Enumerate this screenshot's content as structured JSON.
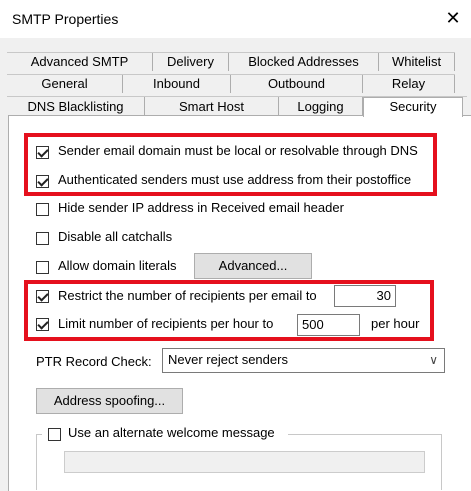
{
  "window": {
    "title": "SMTP Properties",
    "close_glyph": "✕"
  },
  "tabs": {
    "row1": [
      "Advanced SMTP",
      "Delivery",
      "Blocked Addresses",
      "Whitelist"
    ],
    "row2": [
      "General",
      "Inbound",
      "Outbound",
      "Relay"
    ],
    "row3": [
      "DNS Blacklisting",
      "Smart Host",
      "Logging",
      "Security"
    ],
    "active": "Security"
  },
  "security": {
    "sender_domain_local": {
      "label": "Sender email domain must be local or resolvable through DNS",
      "checked": true
    },
    "auth_senders_postoffice": {
      "label": "Authenticated senders must use address from their postoffice",
      "checked": true
    },
    "hide_sender_ip": {
      "label": "Hide sender IP address in Received email header",
      "checked": false
    },
    "disable_catchalls": {
      "label": "Disable all catchalls",
      "checked": false
    },
    "allow_domain_literals": {
      "label": "Allow domain literals",
      "checked": false
    },
    "advanced_button": "Advanced...",
    "restrict_recipients_email": {
      "label": "Restrict the number of recipients per email to",
      "checked": true,
      "value": "30"
    },
    "limit_recipients_hour": {
      "label": "Limit number of recipients per hour to",
      "checked": true,
      "value": "500",
      "suffix": "per hour"
    },
    "ptr_label": "PTR Record Check:",
    "ptr_value": "Never reject senders",
    "address_spoofing_button": "Address spoofing...",
    "alternate_welcome": {
      "label": "Use an alternate welcome message",
      "checked": false,
      "value": ""
    }
  },
  "colors": {
    "highlight": "#e5101d"
  }
}
